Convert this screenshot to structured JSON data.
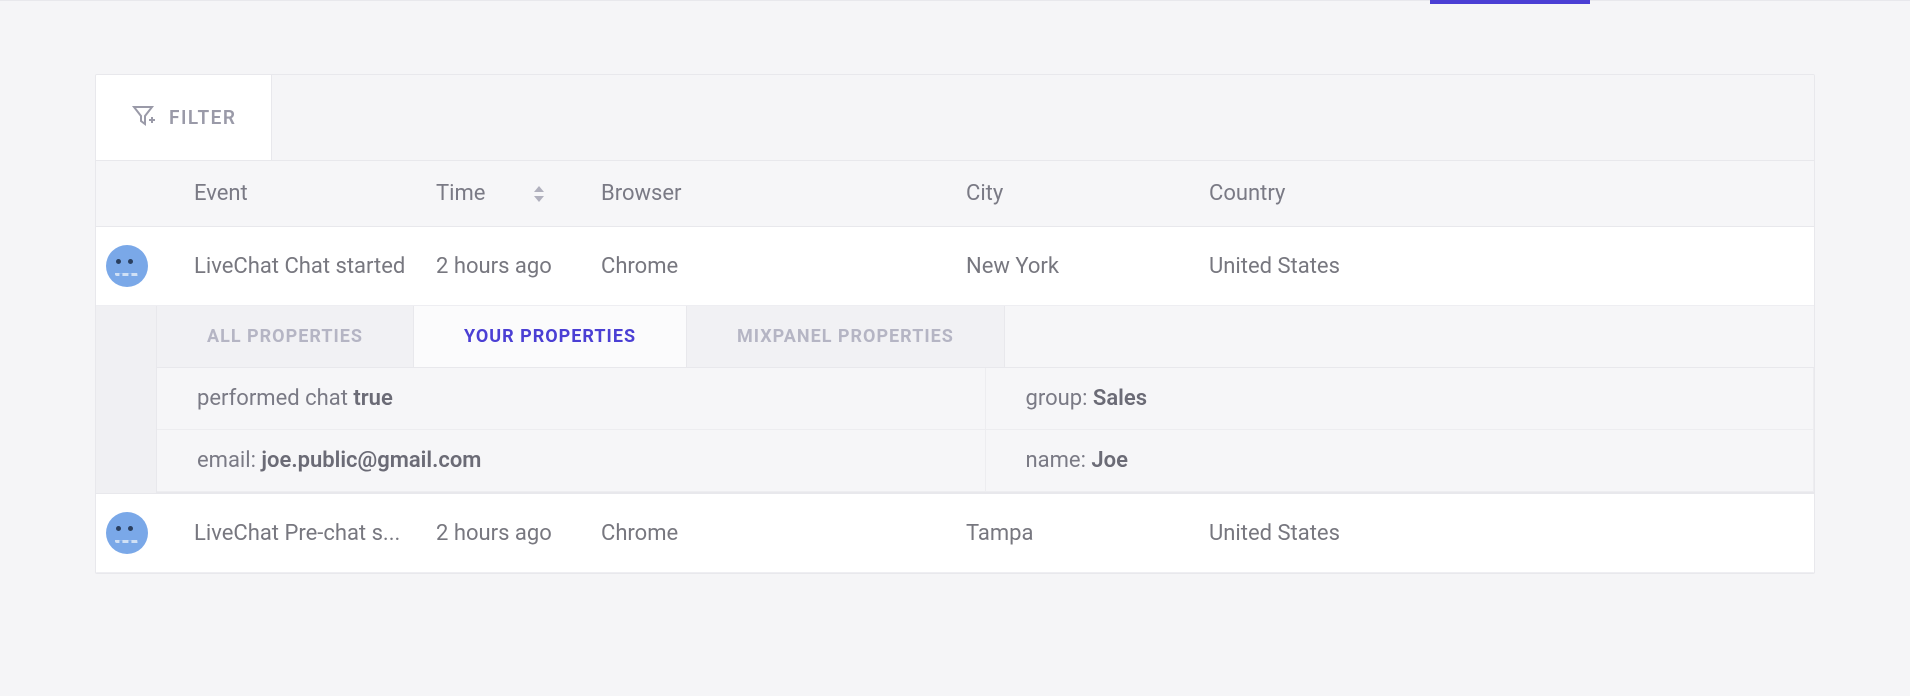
{
  "filter": {
    "label": "FILTER"
  },
  "columns": {
    "event": "Event",
    "time": "Time",
    "browser": "Browser",
    "city": "City",
    "country": "Country"
  },
  "rows": [
    {
      "event": "LiveChat Chat started",
      "time": "2 hours ago",
      "browser": "Chrome",
      "city": "New York",
      "country": "United States",
      "expanded": {
        "tabs": {
          "all": "ALL PROPERTIES",
          "your": "YOUR PROPERTIES",
          "mixpanel": "MIXPANEL PROPERTIES"
        },
        "props": [
          {
            "key": "performed chat ",
            "val": "true"
          },
          {
            "key": "group: ",
            "val": "Sales"
          },
          {
            "key": "email: ",
            "val": "joe.public@gmail.com"
          },
          {
            "key": "name: ",
            "val": "Joe"
          }
        ]
      }
    },
    {
      "event": "LiveChat Pre-chat s...",
      "time": "2 hours ago",
      "browser": "Chrome",
      "city": "Tampa",
      "country": "United States"
    }
  ]
}
